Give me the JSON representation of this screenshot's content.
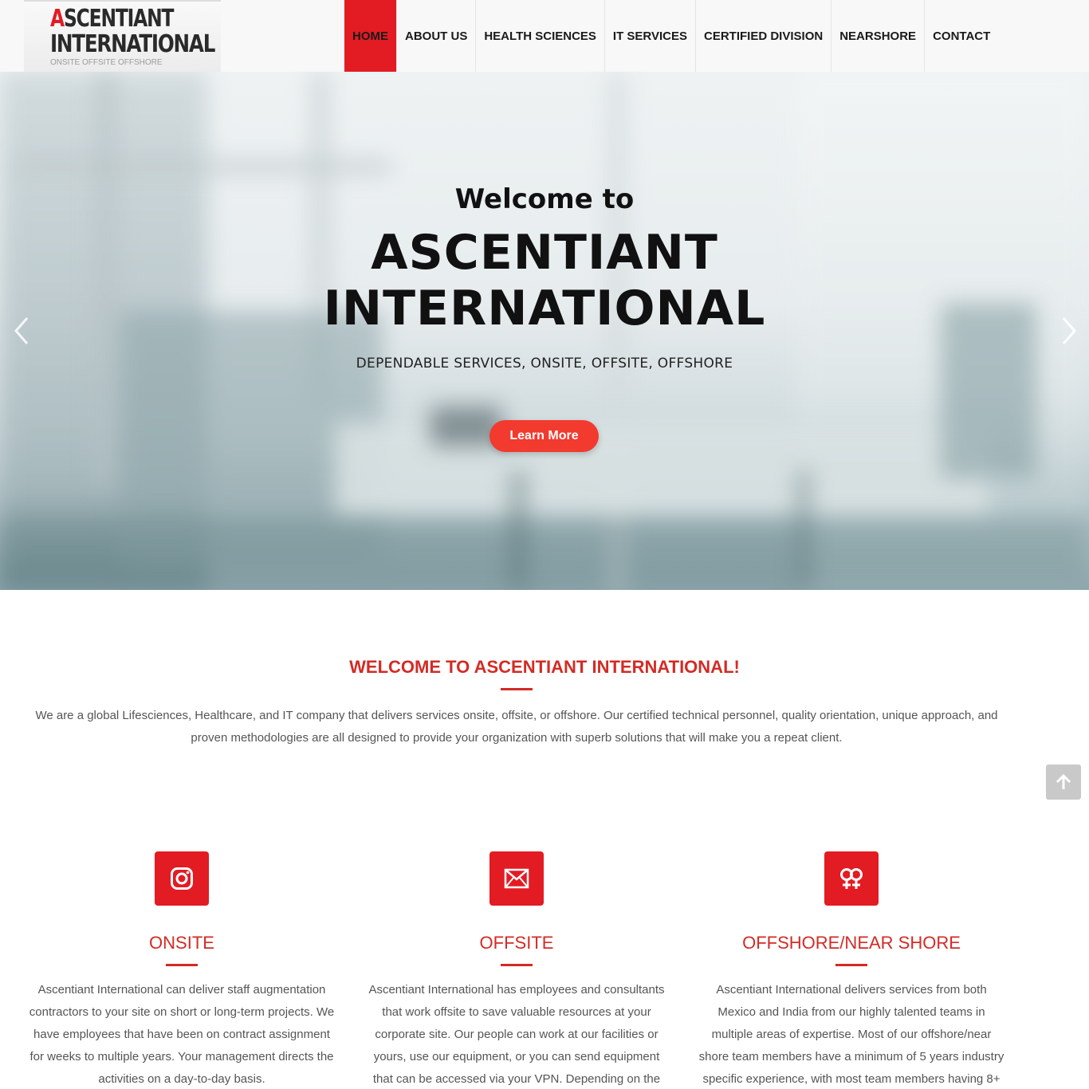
{
  "header": {
    "logo": {
      "first_letter": "A",
      "line1_rest": "SCENTIANT",
      "line2": "INTERNATIONAL",
      "tagline": "ONSITE OFFSITE OFFSHORE"
    },
    "nav": [
      {
        "label": "HOME",
        "active": true
      },
      {
        "label": "ABOUT US"
      },
      {
        "label": "HEALTH SCIENCES"
      },
      {
        "label": "IT SERVICES"
      },
      {
        "label": "CERTIFIED DIVISION"
      },
      {
        "label": "NEARSHORE"
      },
      {
        "label": "CONTACT"
      }
    ]
  },
  "hero": {
    "welcome": "Welcome to",
    "title_line1": "ASCENTIANT",
    "title_line2": "INTERNATIONAL",
    "subtitle": "DEPENDABLE SERVICES, ONSITE, OFFSITE, OFFSHORE",
    "button": "Learn More"
  },
  "welcome": {
    "heading": "WELCOME TO ASCENTIANT INTERNATIONAL!",
    "text_line1": "We are a global Lifesciences, Healthcare, and IT company that delivers services onsite, offsite, or offshore. Our certified technical personnel, quality orientation, unique approach, and",
    "text_line2": "proven methodologies are all designed to provide your organization with superb solutions that will make you a repeat client."
  },
  "features": [
    {
      "icon": "instagram-icon",
      "title": "ONSITE",
      "lines": [
        "Ascentiant International can deliver staff augmentation",
        "contractors to your site on short or long-term projects. We",
        "have employees that have been on contract assignment",
        "for weeks to multiple years. Your management directs the",
        "activities on a day-to-day basis."
      ]
    },
    {
      "icon": "envelope-icon",
      "title": "OFFSITE",
      "lines": [
        "Ascentiant International has employees and consultants",
        "that work offsite to save valuable resources at your",
        "corporate site. Our people can work at our facilities or",
        "yours, use our equipment, or you can send equipment",
        "that can be accessed via your VPN. Depending on the"
      ]
    },
    {
      "icon": "venus-double-icon",
      "title": "OFFSHORE/NEAR SHORE",
      "lines": [
        "Ascentiant International delivers services from both",
        "Mexico and India from our highly talented teams in",
        "multiple areas of expertise. Most of our offshore/near",
        "shore team members have a minimum of 5 years industry",
        "specific experience, with most team members having 8+"
      ]
    }
  ],
  "colors": {
    "accent": "#e31b23",
    "heading": "#d32b25",
    "button": "#f23a2e"
  }
}
